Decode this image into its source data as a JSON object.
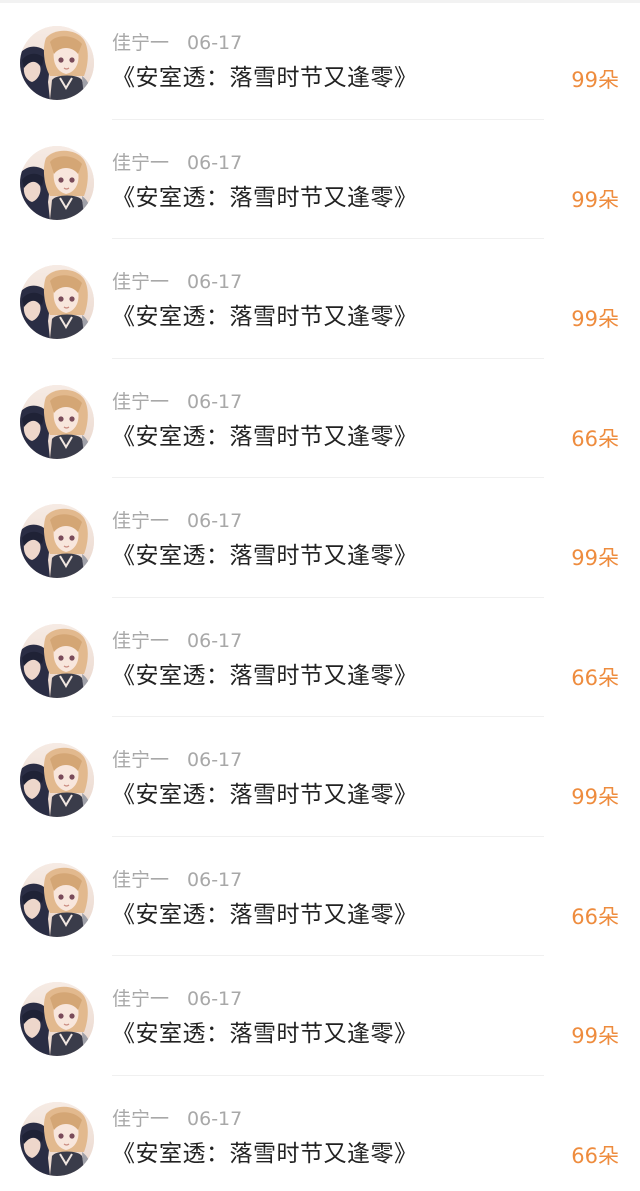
{
  "colors": {
    "meta_text": "#a8a8a8",
    "title_text": "#222222",
    "amount_accent": "#ee8c3e",
    "divider": "#f0f0f0"
  },
  "feed": {
    "items": [
      {
        "user": "佳宁一",
        "date": "06-17",
        "title": "《安室透：落雪时节又逢零》",
        "amount": "99朵",
        "avatar_icon": "anime-character-avatar"
      },
      {
        "user": "佳宁一",
        "date": "06-17",
        "title": "《安室透：落雪时节又逢零》",
        "amount": "99朵",
        "avatar_icon": "anime-character-avatar"
      },
      {
        "user": "佳宁一",
        "date": "06-17",
        "title": "《安室透：落雪时节又逢零》",
        "amount": "99朵",
        "avatar_icon": "anime-character-avatar"
      },
      {
        "user": "佳宁一",
        "date": "06-17",
        "title": "《安室透：落雪时节又逢零》",
        "amount": "66朵",
        "avatar_icon": "anime-character-avatar"
      },
      {
        "user": "佳宁一",
        "date": "06-17",
        "title": "《安室透：落雪时节又逢零》",
        "amount": "99朵",
        "avatar_icon": "anime-character-avatar"
      },
      {
        "user": "佳宁一",
        "date": "06-17",
        "title": "《安室透：落雪时节又逢零》",
        "amount": "66朵",
        "avatar_icon": "anime-character-avatar"
      },
      {
        "user": "佳宁一",
        "date": "06-17",
        "title": "《安室透：落雪时节又逢零》",
        "amount": "99朵",
        "avatar_icon": "anime-character-avatar"
      },
      {
        "user": "佳宁一",
        "date": "06-17",
        "title": "《安室透：落雪时节又逢零》",
        "amount": "66朵",
        "avatar_icon": "anime-character-avatar"
      },
      {
        "user": "佳宁一",
        "date": "06-17",
        "title": "《安室透：落雪时节又逢零》",
        "amount": "99朵",
        "avatar_icon": "anime-character-avatar"
      },
      {
        "user": "佳宁一",
        "date": "06-17",
        "title": "《安室透：落雪时节又逢零》",
        "amount": "66朵",
        "avatar_icon": "anime-character-avatar"
      }
    ]
  }
}
